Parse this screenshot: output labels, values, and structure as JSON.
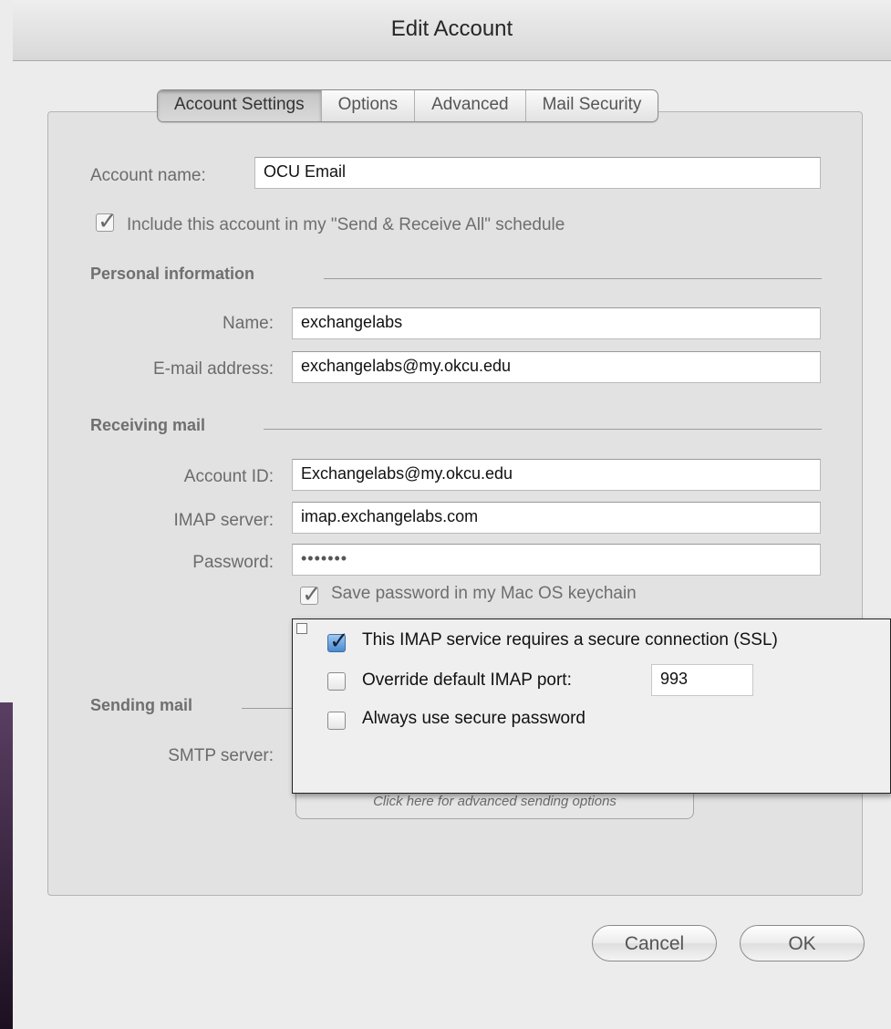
{
  "window": {
    "title": "Edit Account"
  },
  "tabs": [
    {
      "label": "Account Settings",
      "active": true
    },
    {
      "label": "Options",
      "active": false
    },
    {
      "label": "Advanced",
      "active": false
    },
    {
      "label": "Mail Security",
      "active": false
    }
  ],
  "account": {
    "name_label": "Account name:",
    "name_value": "OCU Email",
    "include_label": "Include this account in my \"Send & Receive All\" schedule",
    "include_checked": true
  },
  "personal": {
    "section_title": "Personal information",
    "name_label": "Name:",
    "name_value": "exchangelabs",
    "email_label": "E-mail address:",
    "email_value": "exchangelabs@my.okcu.edu"
  },
  "receiving": {
    "section_title": "Receiving mail",
    "account_id_label": "Account ID:",
    "account_id_value": "Exchangelabs@my.okcu.edu",
    "imap_label": "IMAP server:",
    "imap_value": "imap.exchangelabs.com",
    "password_label": "Password:",
    "password_value": "•••••••",
    "keychain_label": "Save password in my Mac OS keychain",
    "keychain_checked": true
  },
  "popup": {
    "ssl_label": "This IMAP service requires a secure connection (SSL)",
    "ssl_checked": true,
    "override_label": "Override default IMAP port:",
    "override_checked": false,
    "port_value": "993",
    "secure_pw_label": "Always use secure password",
    "secure_pw_checked": false
  },
  "sending": {
    "section_title": "Sending mail",
    "smtp_label": "SMTP server:",
    "advanced_button": "Click here for advanced sending options"
  },
  "buttons": {
    "cancel": "Cancel",
    "ok": "OK"
  }
}
